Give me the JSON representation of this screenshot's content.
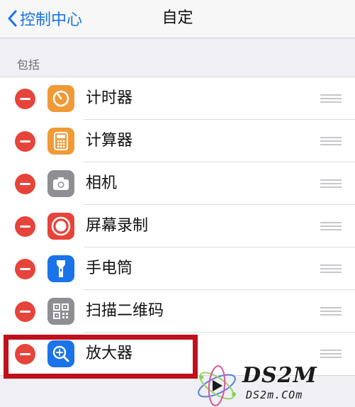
{
  "nav": {
    "back_label": "控制中心",
    "title": "自定"
  },
  "section": {
    "header": "包括"
  },
  "items": [
    {
      "label": "计时器",
      "icon": "timer-icon",
      "color": "#f09a37"
    },
    {
      "label": "计算器",
      "icon": "calculator-icon",
      "color": "#f09a37"
    },
    {
      "label": "相机",
      "icon": "camera-icon",
      "color": "#8e8e93"
    },
    {
      "label": "屏幕录制",
      "icon": "screen-record-icon",
      "color": "#e6443b"
    },
    {
      "label": "手电筒",
      "icon": "flashlight-icon",
      "color": "#1a73e8"
    },
    {
      "label": "扫描二维码",
      "icon": "qr-code-icon",
      "color": "#8e8e93"
    },
    {
      "label": "放大器",
      "icon": "magnifier-icon",
      "color": "#1a73e8"
    }
  ],
  "colors": {
    "accent": "#1a73e8",
    "remove": "#e6443b",
    "highlight": "#c0101b"
  },
  "watermark": {
    "brand": "DS2M",
    "site": "DS2m.COm"
  }
}
